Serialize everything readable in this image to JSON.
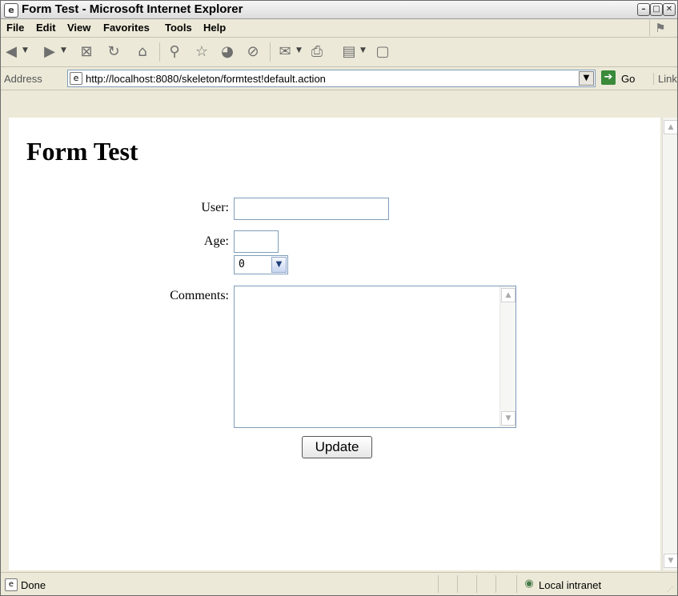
{
  "window": {
    "title": "Form Test - Microsoft Internet Explorer",
    "controls": {
      "minimize": "–",
      "maximize": "□",
      "close": "✕"
    }
  },
  "menu": {
    "items": [
      {
        "label": "File"
      },
      {
        "label": "Edit"
      },
      {
        "label": "View"
      },
      {
        "label": "Favorites"
      },
      {
        "label": "Tools"
      },
      {
        "label": "Help"
      }
    ]
  },
  "address": {
    "label": "Address",
    "url": "http://localhost:8080/skeleton/formtest!default.action",
    "go_label": "Go",
    "links_label": "Links"
  },
  "page": {
    "title": "Form Test",
    "form": {
      "user_label": "User:",
      "user_value": "",
      "age_label": "Age:",
      "age_value": "",
      "select_value": "0",
      "comments_label": "Comments:",
      "comments_value": "",
      "submit_label": "Update"
    }
  },
  "status": {
    "text": "Done",
    "zone": "Local intranet"
  },
  "icons": {
    "ie": "ie-page-icon",
    "back": "back-icon",
    "forward": "forward-icon",
    "stop": "stop-icon",
    "refresh": "refresh-icon",
    "home": "home-icon",
    "search": "search-icon",
    "favorites": "favorites-star-icon",
    "media": "media-icon",
    "history": "history-icon",
    "mail": "mail-icon",
    "print": "print-icon",
    "edit": "edit-icon",
    "discuss": "discuss-icon"
  }
}
